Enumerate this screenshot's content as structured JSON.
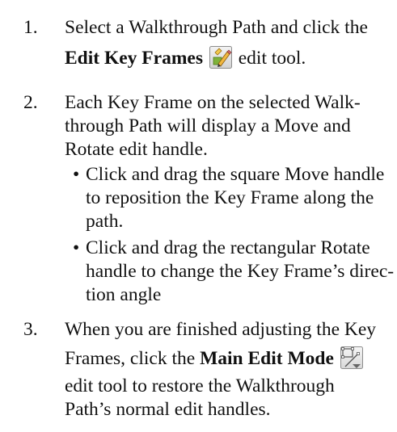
{
  "instructions": {
    "step1": {
      "number": "1.",
      "line1": "Select a Walkthrough Path and click the",
      "tool_name": "Edit Key Frames",
      "after_tool": "edit tool.",
      "icon": "edit-key-frames-icon"
    },
    "step2": {
      "number": "2.",
      "line1": "Each Key Frame on the selected Walk-",
      "line2": "through Path will display a Move and",
      "line3": "Rotate edit handle.",
      "bullets": [
        {
          "lines": [
            "Click and drag the square Move handle",
            "to reposition the Key Frame along the",
            "path."
          ]
        },
        {
          "lines": [
            "Click and drag the rectangular Rotate",
            "handle to change the Key Frame’s direc-",
            "tion angle"
          ]
        }
      ]
    },
    "step3": {
      "number": "3.",
      "line1": "When you are finished adjusting the Key",
      "line2_before": "Frames, click the",
      "tool_name": "Main Edit Mode",
      "line3": "edit tool to restore the Walkthrough",
      "line4": "Path’s normal edit handles.",
      "icon": "main-edit-mode-icon"
    },
    "bullet_char": "•"
  }
}
